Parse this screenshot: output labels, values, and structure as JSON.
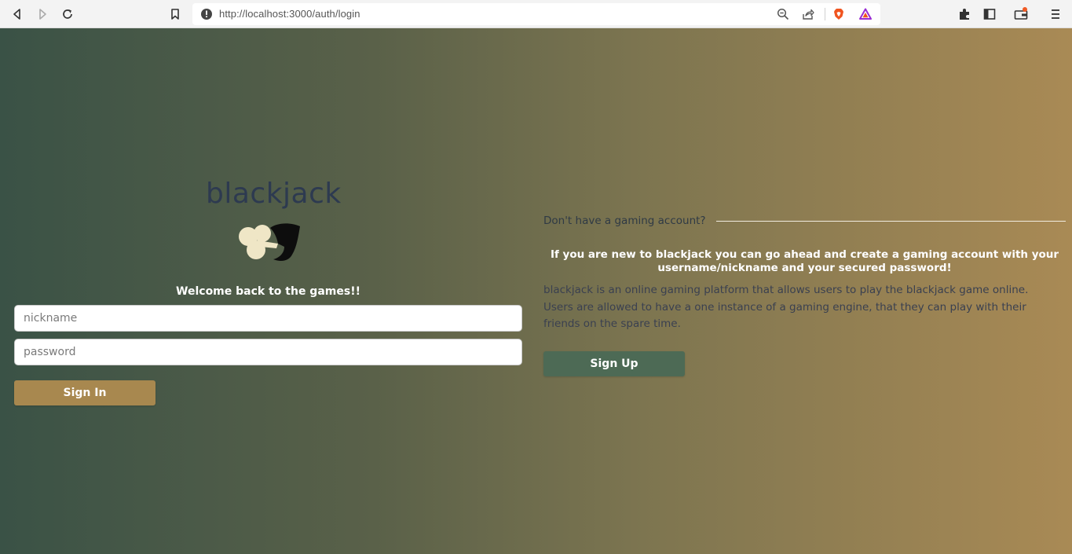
{
  "browser": {
    "url": "http://localhost:3000/auth/login",
    "icons": [
      "back-icon",
      "forward-icon",
      "reload-icon",
      "bookmark-icon",
      "site-info-icon",
      "zoom-icon",
      "share-icon",
      "brave-shield-icon",
      "brave-rewards-icon",
      "extensions-icon",
      "sidebar-icon",
      "wallet-icon",
      "menu-icon"
    ],
    "notification_color": "#f05a24"
  },
  "login": {
    "brand": "blackjack",
    "welcome": "Welcome back to the games!!",
    "nickname_placeholder": "nickname",
    "password_placeholder": "password",
    "signin_label": "Sign In"
  },
  "signup": {
    "heading": "Don't have a gaming account?",
    "intro": "If you are new to blackjack you can go ahead and create a gaming account with your username/nickname and your secured password!",
    "description": "blackjack is an online gaming platform that allows users to play the blackjack game online. Users are allowed to have a one instance of a gaming engine, that they can play with their friends on the spare time.",
    "signup_label": "Sign Up"
  },
  "colors": {
    "gradient_start": "#3a5246",
    "gradient_end": "#a98a55",
    "brand_text": "#2d3a50",
    "signin_button": "#a8884f",
    "signup_button": "#4d6a55"
  }
}
